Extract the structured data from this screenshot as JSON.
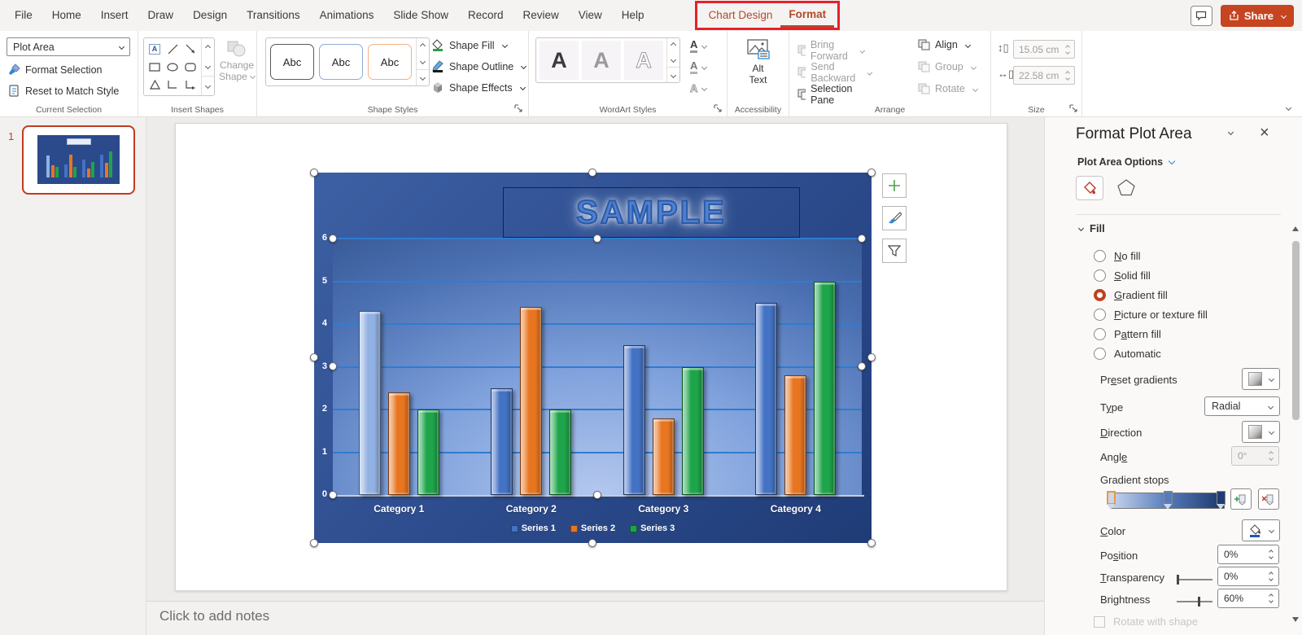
{
  "colors": {
    "contextual_tab": "#B7472A",
    "annotation_box": "#E8202A",
    "share_bg": "#C6441F",
    "selected_radio": "#C2401C"
  },
  "menu_bar": {
    "tabs": [
      "File",
      "Home",
      "Insert",
      "Draw",
      "Design",
      "Transitions",
      "Animations",
      "Slide Show",
      "Record",
      "Review",
      "View",
      "Help"
    ],
    "contextual_tabs": [
      "Chart Design",
      "Format"
    ],
    "active_tab": "Format",
    "share_label": "Share"
  },
  "ribbon": {
    "current_selection": {
      "selector_value": "Plot Area",
      "format_selection": "Format Selection",
      "reset": "Reset to Match Style",
      "group_label": "Current Selection"
    },
    "insert_shapes": {
      "change_shape_line1": "Change",
      "change_shape_line2": "Shape",
      "group_label": "Insert Shapes"
    },
    "shape_styles": {
      "swatch_label": "Abc",
      "swatch_borders": [
        "#5A5A5A",
        "#8FAADC",
        "#F4B183"
      ],
      "fill": "Shape Fill",
      "outline": "Shape Outline",
      "effects": "Shape Effects",
      "group_label": "Shape Styles"
    },
    "wordart": {
      "letter": "A",
      "group_label": "WordArt Styles"
    },
    "accessibility": {
      "alt_line1": "Alt",
      "alt_line2": "Text",
      "group_label": "Accessibility"
    },
    "arrange": {
      "items_col1": [
        {
          "label": "Bring Forward",
          "enabled": false,
          "dropdown": true
        },
        {
          "label": "Send Backward",
          "enabled": false,
          "dropdown": true
        },
        {
          "label": "Selection Pane",
          "enabled": true,
          "dropdown": false
        }
      ],
      "items_col2": [
        {
          "label": "Align",
          "enabled": true,
          "dropdown": true
        },
        {
          "label": "Group",
          "enabled": false,
          "dropdown": true
        },
        {
          "label": "Rotate",
          "enabled": false,
          "dropdown": true
        }
      ],
      "group_label": "Arrange"
    },
    "size": {
      "height_value": "15.05 cm",
      "width_value": "22.58 cm",
      "group_label": "Size"
    }
  },
  "slides": {
    "number": "1"
  },
  "chart_data": {
    "type": "bar",
    "title": "SAMPLE",
    "categories": [
      "Category 1",
      "Category 2",
      "Category 3",
      "Category 4"
    ],
    "series": [
      {
        "name": "Series 1",
        "color": "#4472C4",
        "values": [
          4.3,
          2.5,
          3.5,
          4.5
        ]
      },
      {
        "name": "Series 2",
        "color": "#E8751F",
        "values": [
          2.4,
          4.4,
          1.8,
          2.8
        ]
      },
      {
        "name": "Series 3",
        "color": "#1EA44A",
        "values": [
          2.0,
          2.0,
          3.0,
          5.0
        ]
      }
    ],
    "bar_color_overrides": {
      "0,0": "#92B1E3"
    },
    "ylim": [
      0,
      6
    ],
    "yticks": [
      0,
      1,
      2,
      3,
      4,
      5,
      6
    ],
    "grid": true,
    "legend_position": "bottom"
  },
  "notes": {
    "placeholder": "Click to add notes"
  },
  "pane": {
    "title": "Format Plot Area",
    "options_label": "Plot Area Options",
    "fill_section": "Fill",
    "fill_options": [
      {
        "label": "No fill",
        "key": "N"
      },
      {
        "label": "Solid fill",
        "key": "S"
      },
      {
        "label": "Gradient fill",
        "key": "G"
      },
      {
        "label": "Picture or texture fill",
        "key": "P"
      },
      {
        "label": "Pattern fill",
        "key": "a"
      },
      {
        "label": "Automatic",
        "key": ""
      }
    ],
    "selected_fill": "Gradient fill",
    "rows": {
      "preset": "Preset gradients",
      "type": "Type",
      "type_value": "Radial",
      "direction": "Direction",
      "angle": "Angle",
      "angle_value": "0°",
      "stops": "Gradient stops",
      "color": "Color",
      "position": "Position",
      "position_value": "0%",
      "transparency": "Transparency",
      "transparency_value": "0%",
      "brightness": "Brightness",
      "brightness_value": "60%",
      "rotate_with_shape": "Rotate with shape"
    },
    "gradient_stops": {
      "positions_pct": [
        0,
        50,
        97
      ],
      "colors": [
        "#C9D6EE",
        "#567CBC",
        "#1F3B70"
      ]
    }
  }
}
